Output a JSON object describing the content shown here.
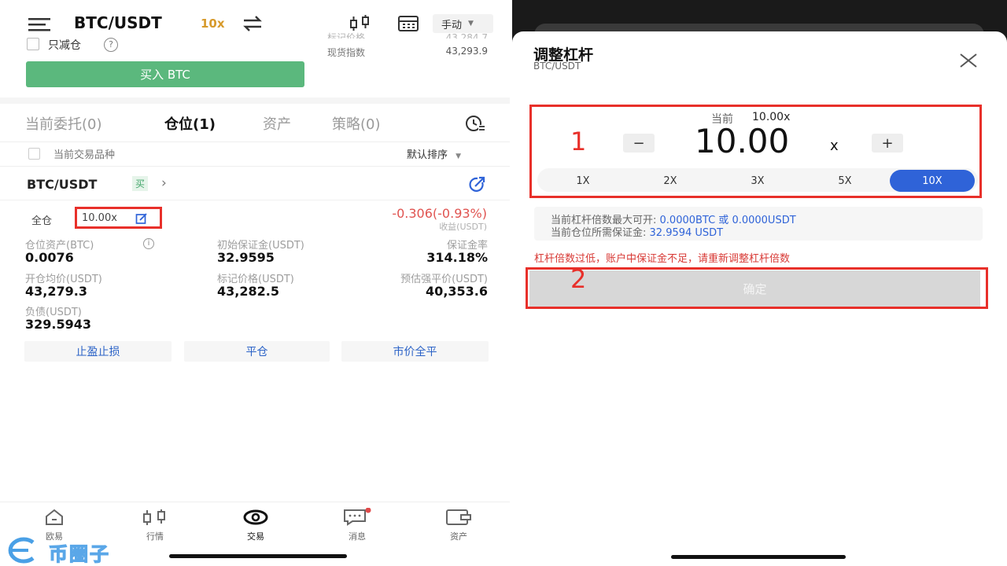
{
  "left": {
    "header": {
      "pair": "BTC/USDT",
      "leverage_badge": "10x",
      "mode": "手动"
    },
    "top_info": {
      "reduce_only": "只减仓",
      "mark_price_label": "标记价格",
      "mark_price_value": "43,284.7",
      "spot_index_label": "现货指数",
      "spot_index_value": "43,293.9"
    },
    "buy_button": "买入 BTC",
    "tabs": [
      "当前委托(0)",
      "仓位(1)",
      "资产",
      "策略(0)"
    ],
    "filter": {
      "label": "当前交易品种",
      "sort": "默认排序"
    },
    "position": {
      "pair": "BTC/USDT",
      "side": "买",
      "margin_mode": "全仓",
      "leverage": "10.00x",
      "pnl": "-0.306(-0.93%)",
      "pnl_label": "收益(USDT)",
      "fields": [
        {
          "label": "仓位资产(BTC)",
          "value": "0.0076"
        },
        {
          "label": "初始保证金(USDT)",
          "value": "32.9595"
        },
        {
          "label": "保证金率",
          "value": "314.18%"
        },
        {
          "label": "开仓均价(USDT)",
          "value": "43,279.3"
        },
        {
          "label": "标记价格(USDT)",
          "value": "43,282.5"
        },
        {
          "label": "预估强平价(USDT)",
          "value": "40,353.6"
        },
        {
          "label": "负债(USDT)",
          "value": "329.5943"
        }
      ],
      "actions": [
        "止盈止损",
        "平仓",
        "市价全平"
      ]
    },
    "bottom_nav": [
      "欧易",
      "行情",
      "交易",
      "消息",
      "资产"
    ],
    "watermark": "币圈子"
  },
  "right": {
    "title": "调整杠杆",
    "subtitle": "BTC/USDT",
    "current_label": "当前",
    "current_value": "10.00x",
    "leverage_value": "10.00",
    "leverage_unit": "x",
    "minus": "−",
    "plus": "+",
    "presets": [
      "1X",
      "2X",
      "3X",
      "5X",
      "10X"
    ],
    "info_line1_prefix": "当前杠杆倍数最大可开: ",
    "info_line1_value": "0.0000BTC 或 0.0000USDT",
    "info_line2_prefix": "当前仓位所需保证金: ",
    "info_line2_value": "32.9594 USDT",
    "warning": "杠杆倍数过低，账户中保证金不足，请重新调整杠杆倍数",
    "confirm": "确定",
    "annotation1": "1",
    "annotation2": "2"
  },
  "colors": {
    "buy": "#5bb87d",
    "accent": "#2f63d8",
    "loss": "#e05350",
    "annotation": "#e8302a"
  }
}
